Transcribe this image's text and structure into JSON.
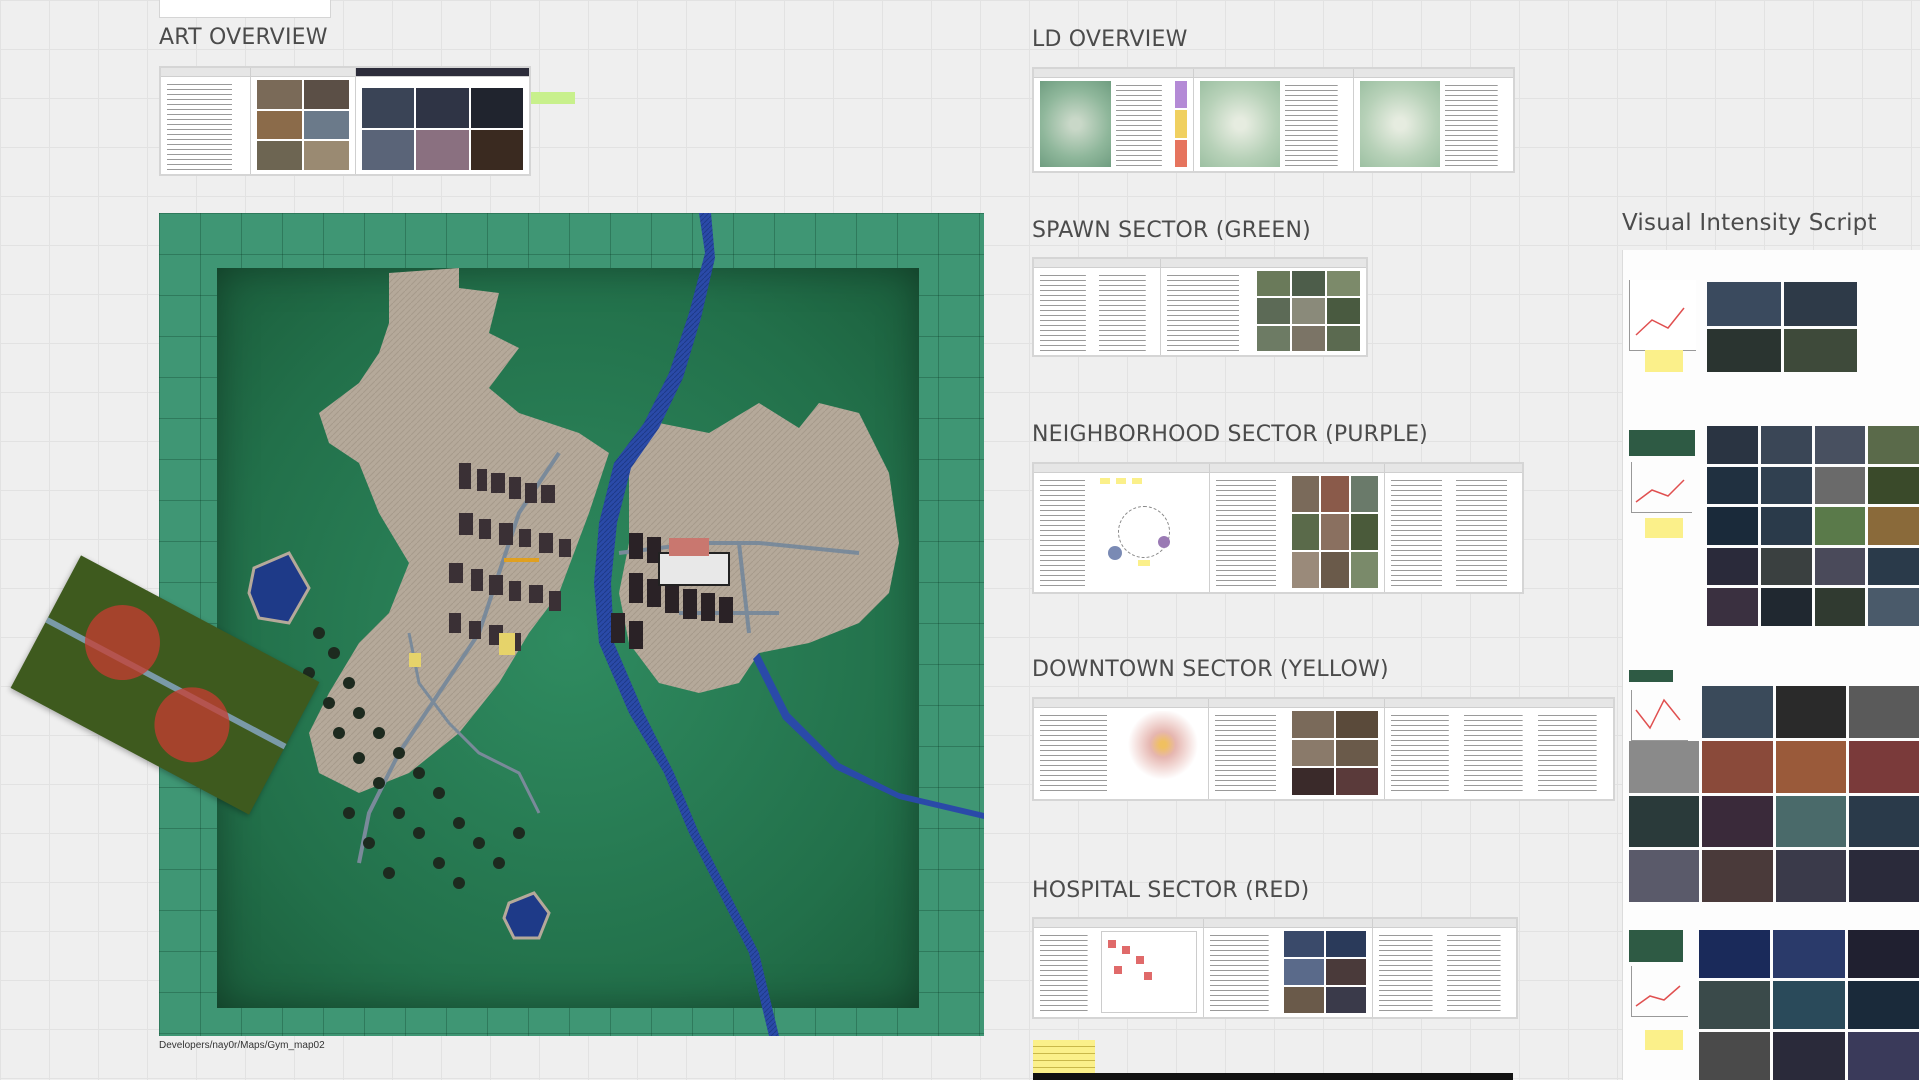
{
  "sections": {
    "art_overview": "ART OVERVIEW",
    "ld_overview": "LD OVERVIEW",
    "spawn_sector": "SPAWN SECTOR (GREEN)",
    "neighborhood_sector": "NEIGHBORHOOD SECTOR (PURPLE)",
    "downtown_sector": "DOWNTOWN SECTOR (YELLOW)",
    "hospital_sector": "HOSPITAL SECTOR (RED)",
    "visual_intensity": "Visual Intensity Script"
  },
  "map": {
    "path_label": "Developers/nay0r/Maps/Gym_map02"
  },
  "colors": {
    "canvas_bg": "#efefef",
    "map_green": "#3f9674",
    "town_tan": "#b5a99a",
    "river_blue": "#2a4aa8",
    "sticky_yellow": "#fbf08a",
    "hospital_red": "#c0392b"
  }
}
